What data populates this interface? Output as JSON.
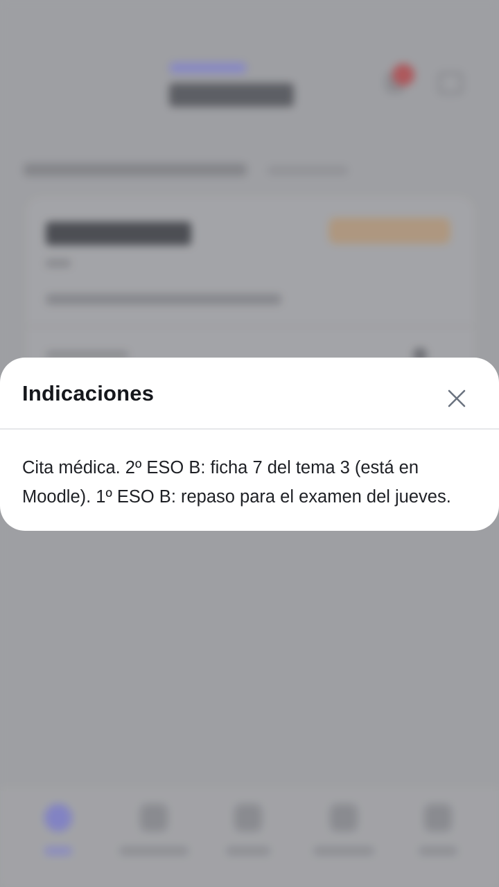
{
  "modal": {
    "title": "Indicaciones",
    "close_icon": "close-icon",
    "body_text": "Cita médica. 2º ESO B: ficha 7 del tema 3 (está en Moodle). 1º ESO B: repaso para el examen del jueves."
  },
  "colors": {
    "modal_background": "#ffffff",
    "title_text": "#15171c",
    "body_text": "#1e2025",
    "close_icon": "#6b7380",
    "scrim": "#a3a4a7"
  },
  "background": {
    "header_icons": [
      "bell-icon",
      "logout-icon"
    ],
    "tab_icons": [
      "home-icon",
      "calendar-icon",
      "clock-icon",
      "clipboard-icon",
      "chart-icon"
    ]
  }
}
